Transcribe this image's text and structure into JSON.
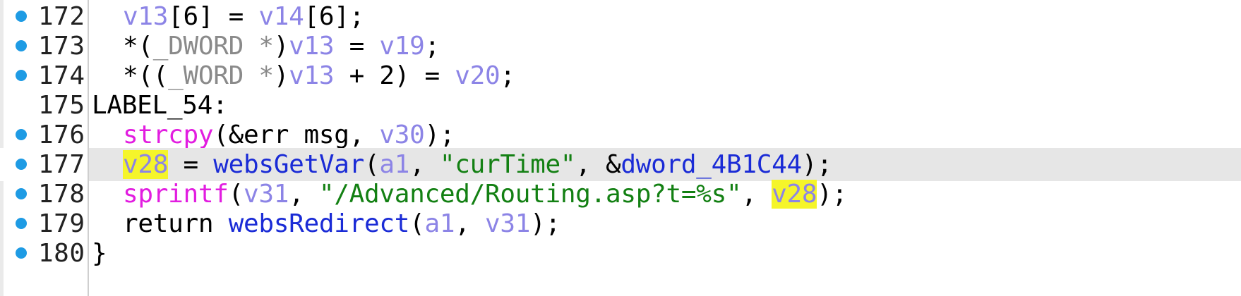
{
  "viewer": {
    "active_line": "177",
    "highlighted_identifier": "v28",
    "lines": [
      {
        "number": "172",
        "has_dot": true,
        "tokens": [
          "v13",
          "[6] = ",
          "v14",
          "[6];"
        ]
      },
      {
        "number": "173",
        "has_dot": true,
        "tokens": [
          "*(",
          "_DWORD *",
          ")",
          "v13",
          " = ",
          "v19",
          ";"
        ]
      },
      {
        "number": "174",
        "has_dot": true,
        "tokens": [
          "*((",
          "_WORD *",
          ")",
          "v13",
          " + 2) = ",
          "v20",
          ";"
        ]
      },
      {
        "number": "175",
        "has_dot": false,
        "tokens": [
          "LABEL_54:"
        ]
      },
      {
        "number": "176",
        "has_dot": true,
        "tokens": [
          "strcpy",
          "(&err_msg, ",
          "v30",
          ");"
        ]
      },
      {
        "number": "177",
        "has_dot": true,
        "tokens": [
          "v28",
          " = ",
          "websGetVar",
          "(",
          "a1",
          ", ",
          "\"curTime\"",
          ", &",
          "dword_4B1C44",
          ");"
        ]
      },
      {
        "number": "178",
        "has_dot": true,
        "tokens": [
          "sprintf",
          "(",
          "v31",
          ", ",
          "\"/Advanced/Routing.asp?t=%s\"",
          ", ",
          "v28",
          ");"
        ]
      },
      {
        "number": "179",
        "has_dot": true,
        "tokens": [
          "return ",
          "websRedirect",
          "(",
          "a1",
          ", ",
          "v31",
          ");"
        ]
      },
      {
        "number": "180",
        "has_dot": true,
        "tokens": [
          "}"
        ]
      }
    ]
  },
  "colors": {
    "variable": "#8c84e6",
    "type": "#8a8a8a",
    "function": "#1a2bd6",
    "library_function": "#e21de0",
    "string": "#138013",
    "highlight": "#f5f52a",
    "active_line_bg": "#e6e6e6",
    "breakpoint_dot": "#1e9be4"
  }
}
